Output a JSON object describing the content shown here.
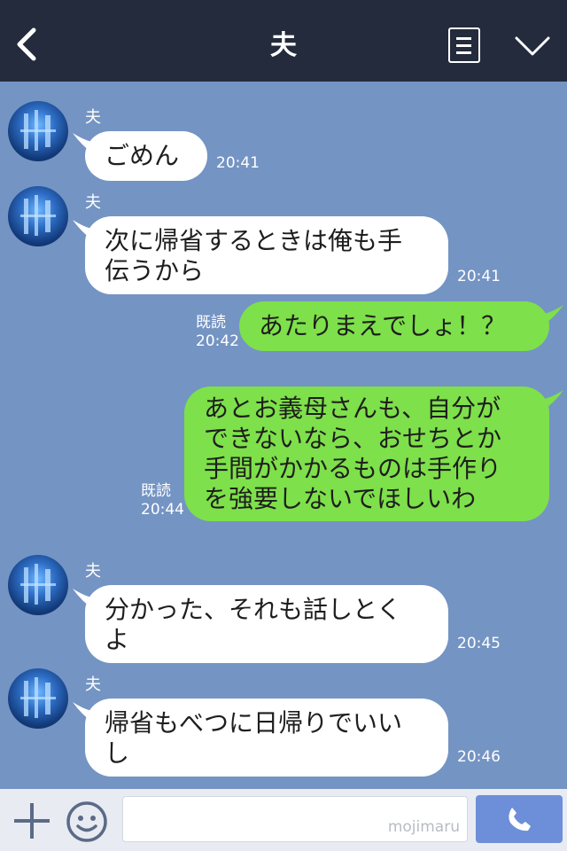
{
  "header": {
    "title": "夫"
  },
  "messages": [
    {
      "side": "in",
      "sender": "夫",
      "lines": [
        "ごめん"
      ],
      "time": "20:41"
    },
    {
      "side": "in",
      "sender": "夫",
      "lines": [
        "次に帰省するときは俺も手",
        "伝うから"
      ],
      "time": "20:41"
    },
    {
      "side": "out",
      "read": "既読",
      "lines": [
        "あたりまえでしょ！？"
      ],
      "time": "20:42"
    },
    {
      "side": "out",
      "read": "既読",
      "lines": [
        "あとお義母さんも、自分が",
        "できないなら、おせちとか",
        "手間がかかるものは手作り",
        "を強要しないでほしいわ"
      ],
      "time": "20:44"
    },
    {
      "side": "in",
      "sender": "夫",
      "lines": [
        "分かった、それも話しとく",
        "よ"
      ],
      "time": "20:45"
    },
    {
      "side": "in",
      "sender": "夫",
      "lines": [
        "帰省もべつに日帰りでいい",
        "し"
      ],
      "time": "20:46"
    }
  ],
  "footer": {
    "input_watermark": "mojimaru"
  },
  "colors": {
    "header_bg": "#232b3d",
    "chat_bg": "#7494c3",
    "outgoing_bubble": "#7ee04a",
    "incoming_bubble": "#ffffff",
    "call_button": "#6d8fd9"
  },
  "icons": [
    "back-arrow-icon",
    "menu-list-icon",
    "chevron-down-icon",
    "plus-icon",
    "emoji-icon",
    "phone-icon"
  ]
}
